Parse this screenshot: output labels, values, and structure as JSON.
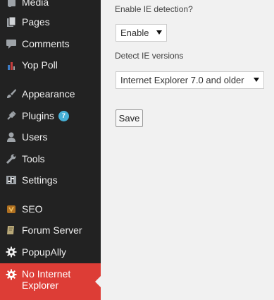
{
  "sidebar": {
    "items": [
      {
        "name": "media",
        "label": "Media"
      },
      {
        "name": "pages",
        "label": "Pages"
      },
      {
        "name": "comments",
        "label": "Comments"
      },
      {
        "name": "yop-poll",
        "label": "Yop Poll"
      },
      {
        "name": "appearance",
        "label": "Appearance"
      },
      {
        "name": "plugins",
        "label": "Plugins",
        "badge": "7"
      },
      {
        "name": "users",
        "label": "Users"
      },
      {
        "name": "tools",
        "label": "Tools"
      },
      {
        "name": "settings",
        "label": "Settings"
      },
      {
        "name": "seo",
        "label": "SEO"
      },
      {
        "name": "forum-server",
        "label": "Forum Server"
      },
      {
        "name": "popupally",
        "label": "PopupAlly"
      },
      {
        "name": "no-internet-explorer",
        "label": "No Internet Explorer",
        "current": true
      }
    ]
  },
  "form": {
    "enable_label": "Enable IE detection?",
    "enable_value": "Enable",
    "versions_label": "Detect IE versions",
    "versions_value": "Internet Explorer 7.0 and older",
    "save_label": "Save"
  },
  "colors": {
    "sidebar_bg": "#222222",
    "current_bg": "#dd3d36",
    "badge_bg": "#46b0d6",
    "content_bg": "#f1f1f1"
  }
}
